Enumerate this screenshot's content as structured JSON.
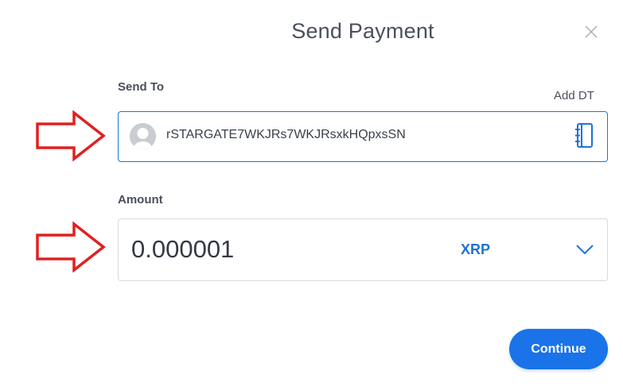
{
  "dialog": {
    "title": "Send Payment"
  },
  "send_to": {
    "label": "Send To",
    "add_link": "Add DT",
    "address": "rSTARGATE7WKJRs7WKJRsxkHQpxsSN"
  },
  "amount": {
    "label": "Amount",
    "value": "0.000001",
    "currency": "XRP"
  },
  "actions": {
    "continue_label": "Continue"
  },
  "colors": {
    "accent": "#1a73e8",
    "annotation_arrow": "#e02020"
  }
}
